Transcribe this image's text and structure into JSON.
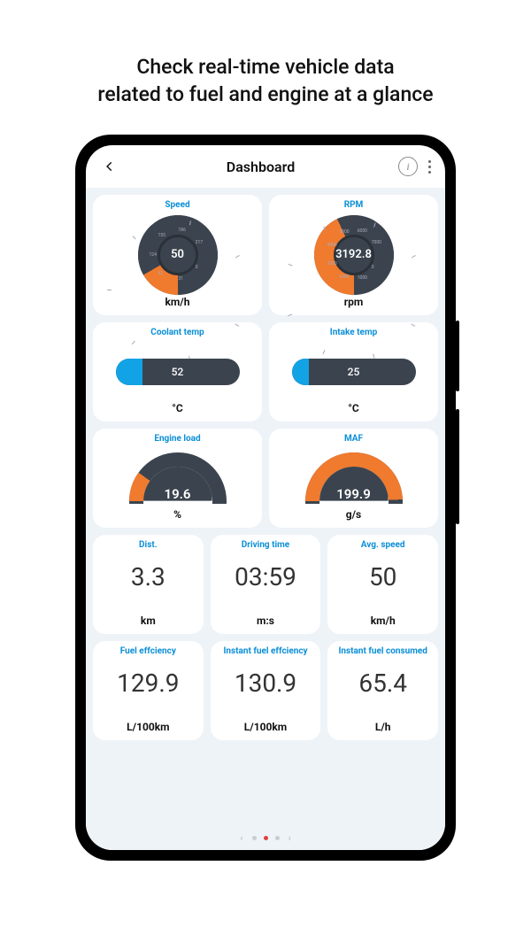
{
  "promo": {
    "line1": "Check real-time vehicle data",
    "line2": "related to fuel and engine at a glance"
  },
  "header": {
    "title": "Dashboard"
  },
  "gauges": {
    "speed": {
      "title": "Speed",
      "value": "50",
      "unit": "km/h",
      "max": 220,
      "angle": 225
    },
    "rpm": {
      "title": "RPM",
      "value": "3192.8",
      "unit": "rpm",
      "max": 7000,
      "angle": 300
    },
    "coolant": {
      "title": "Coolant temp",
      "value": "52",
      "unit": "°C",
      "fill_pct": 22
    },
    "intake": {
      "title": "Intake temp",
      "value": "25",
      "unit": "°C",
      "fill_pct": 14
    },
    "engine_load": {
      "title": "Engine load",
      "value": "19.6",
      "unit": "%",
      "angle": 215
    },
    "maf": {
      "title": "MAF",
      "value": "199.9",
      "unit": "g/s",
      "angle": 358
    }
  },
  "stats_row1": [
    {
      "title": "Dist.",
      "value": "3.3",
      "unit": "km"
    },
    {
      "title": "Driving time",
      "value": "03:59",
      "unit": "m:s"
    },
    {
      "title": "Avg. speed",
      "value": "50",
      "unit": "km/h"
    }
  ],
  "stats_row2": [
    {
      "title": "Fuel effciency",
      "value": "129.9",
      "unit": "L/100km"
    },
    {
      "title": "Instant fuel effciency",
      "value": "130.9",
      "unit": "L/100km"
    },
    {
      "title": "Instant fuel consumed",
      "value": "65.4",
      "unit": "L/h"
    }
  ],
  "pager": {
    "active": 1,
    "total": 3
  }
}
